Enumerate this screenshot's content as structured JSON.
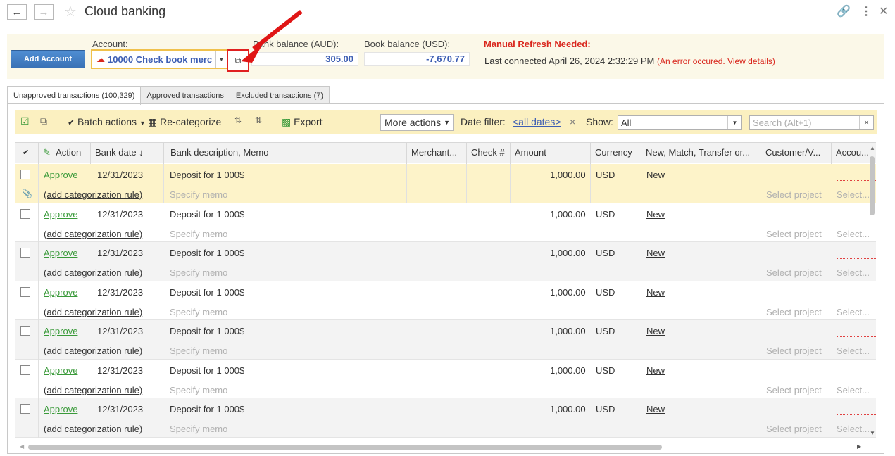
{
  "app": {
    "title": "Cloud banking",
    "back_icon": "back-arrow-icon",
    "forward_icon": "forward-arrow-icon"
  },
  "header": {
    "add_account_label": "Add Account",
    "account_label": "Account:",
    "account_value": "10000 Check book merc",
    "bank_balance_label": "Bank balance (AUD):",
    "bank_balance_value": "305.00",
    "book_balance_label": "Book balance (USD):",
    "book_balance_value": "-7,670.77",
    "manual_refresh": "Manual Refresh Needed:",
    "last_connected": "Last connected April 26, 2024 2:32:29 PM",
    "error_link": "(An error occured. View details)"
  },
  "tabs": [
    {
      "label": "Unapproved transactions (100,329)"
    },
    {
      "label": "Approved transactions"
    },
    {
      "label": "Excluded transactions (7)"
    }
  ],
  "toolbar": {
    "batch_actions": "Batch actions",
    "recategorize": "Re-categorize",
    "export": "Export",
    "more_actions": "More actions",
    "date_filter_label": "Date filter:",
    "date_filter_value": "<all dates>",
    "show_label": "Show:",
    "show_value": "All",
    "search_placeholder": "Search (Alt+1)"
  },
  "columns": {
    "action": "Action",
    "bank_date": "Bank date",
    "description": "Bank description, Memo",
    "merchant": "Merchant...",
    "check": "Check #",
    "amount": "Amount",
    "currency": "Currency",
    "match": "New, Match, Transfer or...",
    "customer": "Customer/V...",
    "account": "Accou..."
  },
  "rows": [
    {
      "approve": "Approve",
      "date": "12/31/2023",
      "description": "Deposit for 1 000$",
      "amount": "1,000.00",
      "currency": "USD",
      "match": "New",
      "rule": "(add categorization rule)",
      "memo": "Specify memo",
      "project": "Select project",
      "account": "Select..."
    },
    {
      "approve": "Approve",
      "date": "12/31/2023",
      "description": "Deposit for 1 000$",
      "amount": "1,000.00",
      "currency": "USD",
      "match": "New",
      "rule": "(add categorization rule)",
      "memo": "Specify memo",
      "project": "Select project",
      "account": "Select..."
    },
    {
      "approve": "Approve",
      "date": "12/31/2023",
      "description": "Deposit for 1 000$",
      "amount": "1,000.00",
      "currency": "USD",
      "match": "New",
      "rule": "(add categorization rule)",
      "memo": "Specify memo",
      "project": "Select project",
      "account": "Select..."
    },
    {
      "approve": "Approve",
      "date": "12/31/2023",
      "description": "Deposit for 1 000$",
      "amount": "1,000.00",
      "currency": "USD",
      "match": "New",
      "rule": "(add categorization rule)",
      "memo": "Specify memo",
      "project": "Select project",
      "account": "Select..."
    },
    {
      "approve": "Approve",
      "date": "12/31/2023",
      "description": "Deposit for 1 000$",
      "amount": "1,000.00",
      "currency": "USD",
      "match": "New",
      "rule": "(add categorization rule)",
      "memo": "Specify memo",
      "project": "Select project",
      "account": "Select..."
    },
    {
      "approve": "Approve",
      "date": "12/31/2023",
      "description": "Deposit for 1 000$",
      "amount": "1,000.00",
      "currency": "USD",
      "match": "New",
      "rule": "(add categorization rule)",
      "memo": "Specify memo",
      "project": "Select project",
      "account": "Select..."
    },
    {
      "approve": "Approve",
      "date": "12/31/2023",
      "description": "Deposit for 1 000$",
      "amount": "1,000.00",
      "currency": "USD",
      "match": "New",
      "rule": "(add categorization rule)",
      "memo": "Specify memo",
      "project": "Select project",
      "account": "Select..."
    }
  ],
  "colors": {
    "accent_blue": "#3d5eb3",
    "approve_green": "#3a9a3a",
    "error_red": "#d9261c",
    "toolbar_yellow": "#fbf0c0",
    "highlight": "#e02020"
  }
}
